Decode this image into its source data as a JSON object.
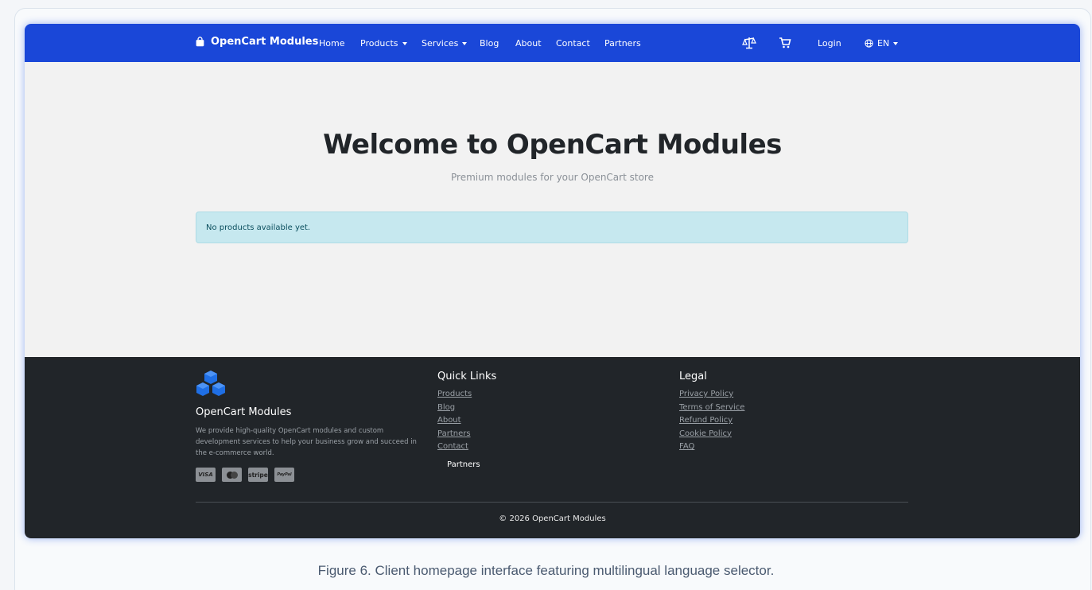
{
  "navbar": {
    "brand": "OpenCart Modules",
    "items": [
      {
        "label": "Home"
      },
      {
        "label": "Products"
      },
      {
        "label": "Services"
      },
      {
        "label": "Blog"
      },
      {
        "label": "About"
      },
      {
        "label": "Contact"
      },
      {
        "label": "Partners"
      }
    ],
    "login": "Login",
    "language": "EN",
    "icons": [
      "shopping-bag-icon",
      "compare-scale-icon",
      "cart-icon",
      "globe-icon",
      "caret-down-icon"
    ]
  },
  "hero": {
    "title": "Welcome to OpenCart Modules",
    "subtitle": "Premium modules for your OpenCart store"
  },
  "alert": {
    "text": "No products available yet."
  },
  "footer": {
    "brand": "OpenCart Modules",
    "description": "We provide high-quality OpenCart modules and custom development services to help your business grow and succeed in the e-commerce world.",
    "payment_methods": [
      "VISA",
      "mastercard",
      "stripe",
      "PayPal"
    ],
    "quick_links": {
      "title": "Quick Links",
      "items": [
        "Products",
        "Blog",
        "About",
        "Partners",
        "Contact"
      ],
      "extra": "Partners"
    },
    "legal": {
      "title": "Legal",
      "items": [
        "Privacy Policy",
        "Terms of Service",
        "Refund Policy",
        "Cookie Policy",
        "FAQ"
      ]
    },
    "copyright": "© 2026 OpenCart Modules"
  },
  "caption": "Figure 6. Client homepage interface featuring multilingual language selector.",
  "colors": {
    "navbar": "#1a47d8",
    "footer": "#212529",
    "alert_bg": "#c6e8ef",
    "logo_blue": "#1f6fe5"
  }
}
